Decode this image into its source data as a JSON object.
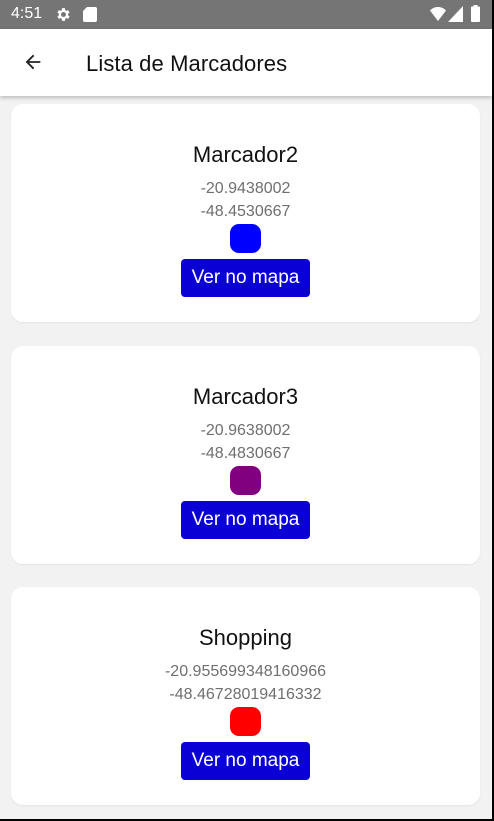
{
  "status_bar": {
    "time": "4:51",
    "icons": [
      "gear-icon",
      "sd-card-icon",
      "wifi-icon",
      "signal-icon",
      "battery-icon"
    ]
  },
  "app_bar": {
    "back_icon": "arrow-back-icon",
    "title": "Lista de Marcadores"
  },
  "markers": [
    {
      "name": "Marcador2",
      "lat": "-20.9438002",
      "lng": "-48.4530667",
      "color": "#0000ff",
      "button_label": "Ver no mapa"
    },
    {
      "name": "Marcador3",
      "lat": "-20.9638002",
      "lng": "-48.4830667",
      "color": "#800080",
      "button_label": "Ver no mapa"
    },
    {
      "name": "Shopping",
      "lat": "-20.955699348160966",
      "lng": "-48.46728019416332",
      "color": "#ff0000",
      "button_label": "Ver no mapa"
    }
  ],
  "colors": {
    "button": "#0a00d6",
    "status_bar": "#757575"
  }
}
